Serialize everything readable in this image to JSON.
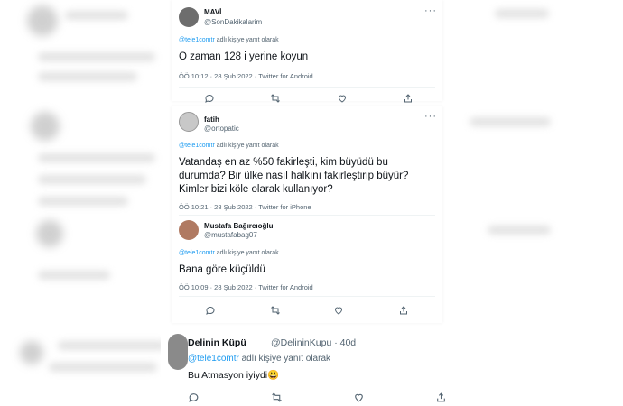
{
  "tweets": [
    {
      "name": "MAVİ",
      "handle": "@SonDakikalarim",
      "reply_prefix": "@tele1comtr",
      "reply_suffix": "adlı kişiye yanıt olarak",
      "text": "O zaman 128 i yerine koyun",
      "meta": "ÖÖ 10:12 · 28 Şub 2022 · Twitter for Android"
    },
    {
      "name": "fatih",
      "handle": "@ortopatic",
      "reply_prefix": "@tele1comtr",
      "reply_suffix": "adlı kişiye yanıt olarak",
      "text_lines": [
        "Vatandaş en az %50 fakirleşti, kim büyüdü bu",
        "durumda? Bir ülke nasıl halkını fakirleştirip büyür?",
        "Kimler bizi köle olarak kullanıyor?"
      ],
      "meta": "ÖÖ 10:21 · 28 Şub 2022 · Twitter for iPhone"
    },
    {
      "name": "Mustafa Bağırcıoğlu",
      "handle": "@mustafabag07",
      "reply_prefix": "@tele1comtr",
      "reply_suffix": "adlı kişiye yanıt olarak",
      "text": "Bana göre küçüldü",
      "meta": "ÖÖ 10:09 · 28 Şub 2022 · Twitter for Android"
    },
    {
      "name": "Delinin Küpü",
      "handle": "@DelininKupu · 40d",
      "reply_prefix": "@tele1comtr",
      "reply_suffix": "adlı kişiye yanıt olarak",
      "text": "Bu Atmasyon iyiydi😃"
    }
  ],
  "more_label": "···",
  "icons": [
    "reply-icon",
    "retweet-icon",
    "like-icon",
    "share-icon"
  ],
  "colors": {
    "link": "#1d9bf0",
    "muted": "#536471",
    "text": "#0f1419"
  }
}
